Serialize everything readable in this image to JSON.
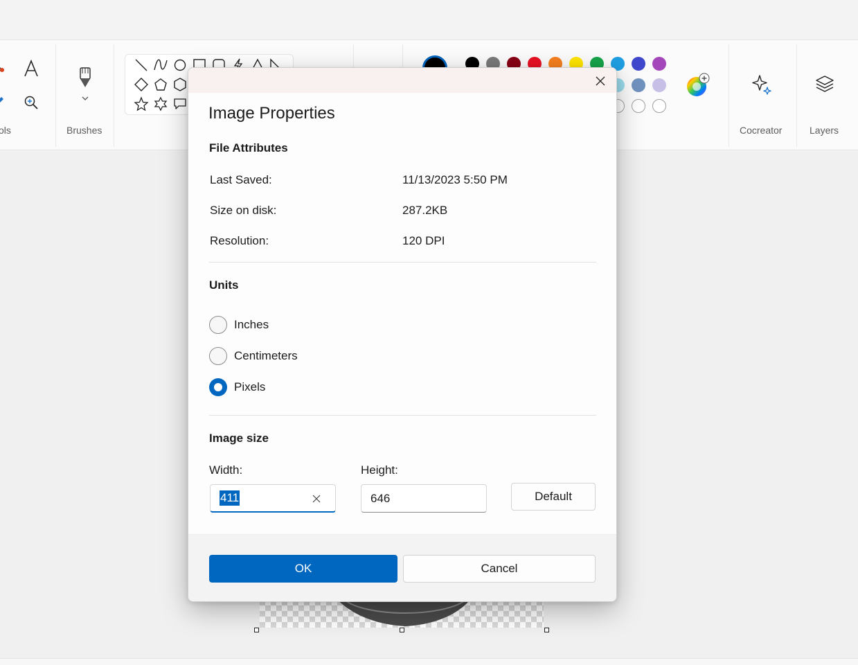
{
  "ribbon": {
    "groups": {
      "tools_label": "ols",
      "brushes_label": "Brushes",
      "cocreator_label": "Cocreator",
      "layers_label": "Layers"
    },
    "colors": {
      "primary": "#000000",
      "swatches_row1": [
        "#000000",
        "#7a7a7a",
        "#880015",
        "#e81123",
        "#f7801f",
        "#ffe500",
        "#16a34a",
        "#1e9fe3",
        "#3f48cc",
        "#a347ba"
      ],
      "swatches_row2": [
        "#99d9ea",
        "#7092be",
        "#c8bfe7"
      ]
    }
  },
  "dialog": {
    "title": "Image Properties",
    "file_attributes": {
      "heading": "File Attributes",
      "rows": [
        {
          "label": "Last Saved:",
          "value": "11/13/2023 5:50 PM"
        },
        {
          "label": "Size on disk:",
          "value": "287.2KB"
        },
        {
          "label": "Resolution:",
          "value": "120 DPI"
        }
      ]
    },
    "units": {
      "heading": "Units",
      "options": [
        {
          "label": "Inches",
          "checked": false
        },
        {
          "label": "Centimeters",
          "checked": false
        },
        {
          "label": "Pixels",
          "checked": true
        }
      ]
    },
    "image_size": {
      "heading": "Image size",
      "width_label": "Width:",
      "width_value": "411",
      "height_label": "Height:",
      "height_value": "646",
      "default_label": "Default"
    },
    "ok_label": "OK",
    "cancel_label": "Cancel"
  }
}
